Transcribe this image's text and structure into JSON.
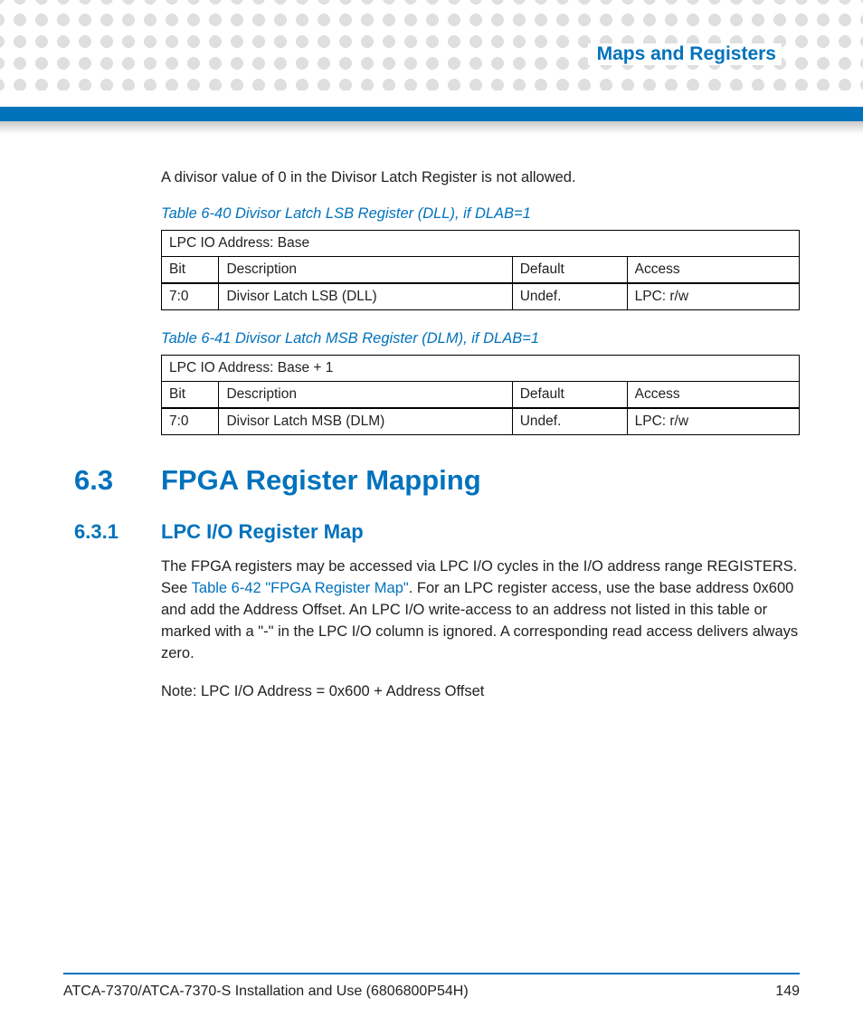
{
  "header": {
    "title": "Maps and Registers"
  },
  "intro_text": "A divisor value of 0 in the Divisor Latch Register is not allowed.",
  "table1": {
    "caption": "Table 6-40 Divisor Latch LSB Register (DLL), if DLAB=1",
    "addr_row": "LPC IO Address: Base",
    "h_bit": "Bit",
    "h_desc": "Description",
    "h_def": "Default",
    "h_acc": "Access",
    "r1_bit": "7:0",
    "r1_desc": "Divisor Latch LSB (DLL)",
    "r1_def": "Undef.",
    "r1_acc": "LPC: r/w"
  },
  "table2": {
    "caption": "Table 6-41 Divisor Latch MSB Register (DLM), if DLAB=1",
    "addr_row": "LPC IO Address: Base + 1",
    "h_bit": "Bit",
    "h_desc": "Description",
    "h_def": "Default",
    "h_acc": "Access",
    "r1_bit": "7:0",
    "r1_desc": "Divisor Latch MSB (DLM)",
    "r1_def": "Undef.",
    "r1_acc": "LPC: r/w"
  },
  "section1": {
    "num": "6.3",
    "title": "FPGA Register Mapping"
  },
  "section2": {
    "num": "6.3.1",
    "title": "LPC I/O Register Map"
  },
  "para": {
    "pre": "The FPGA registers may be accessed via LPC I/O cycles in the I/O address range REGISTERS. See ",
    "link": "Table 6-42 \"FPGA Register Map\"",
    "post": ". For an LPC register access, use the base address 0x600 and add the Address Offset. An LPC I/O write-access to an address not listed in this table or marked with a \"-\" in the LPC I/O column is ignored. A corresponding read access delivers always zero."
  },
  "note_text": "Note: LPC I/O Address = 0x600 + Address Offset",
  "footer": {
    "left": "ATCA-7370/ATCA-7370-S Installation and Use (6806800P54H)",
    "right": "149"
  }
}
